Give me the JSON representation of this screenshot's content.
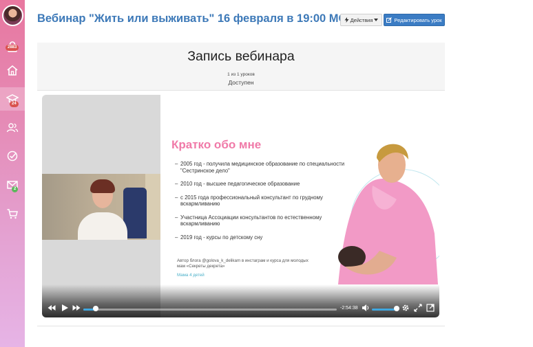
{
  "sidebar": {
    "items": [
      {
        "icon": "lock-icon",
        "badge": "2883",
        "badge_color": "red"
      },
      {
        "icon": "home-icon"
      },
      {
        "icon": "graduation-cap-icon",
        "badge": "24",
        "badge_color": "red",
        "active": true
      },
      {
        "icon": "users-icon"
      },
      {
        "icon": "check-circle-icon"
      },
      {
        "icon": "mail-icon",
        "badge": "2",
        "badge_color": "green"
      },
      {
        "icon": "cart-icon"
      }
    ]
  },
  "header": {
    "title": "Вебинар \"Жить или выживать\" 16 февраля в 19:00 МСК",
    "actions_label": "Действия",
    "edit_label": "Редактировать урок"
  },
  "lesson": {
    "title": "Запись вебинара",
    "count": "1 из 1 уроков",
    "status": "Доступен"
  },
  "slide": {
    "title": "Кратко обо мне",
    "bullets": [
      "2005 год - получила медицинское образование по специальности \"Сестринское дело\"",
      "2010 год - высшее педагогическое образование",
      "с 2015 года профессиональный консультант по грудному вскармливанию",
      "Участница Ассоциации консультантов по естественному вскармливанию",
      "2019 год - курсы по детскому сну"
    ],
    "author_text": "Автор блога @golova_k_delikam в инстаграм и курса для молодых мам «Секреты декрета»",
    "signature": "Мама 4 детей"
  },
  "player": {
    "time_remaining": "-2:54:38",
    "progress": 0.05,
    "volume": 1.0
  },
  "colors": {
    "accent": "#3b7cc4",
    "title": "#3d79b8",
    "slide_title": "#f07aa8",
    "progress": "#3fa7e0"
  }
}
